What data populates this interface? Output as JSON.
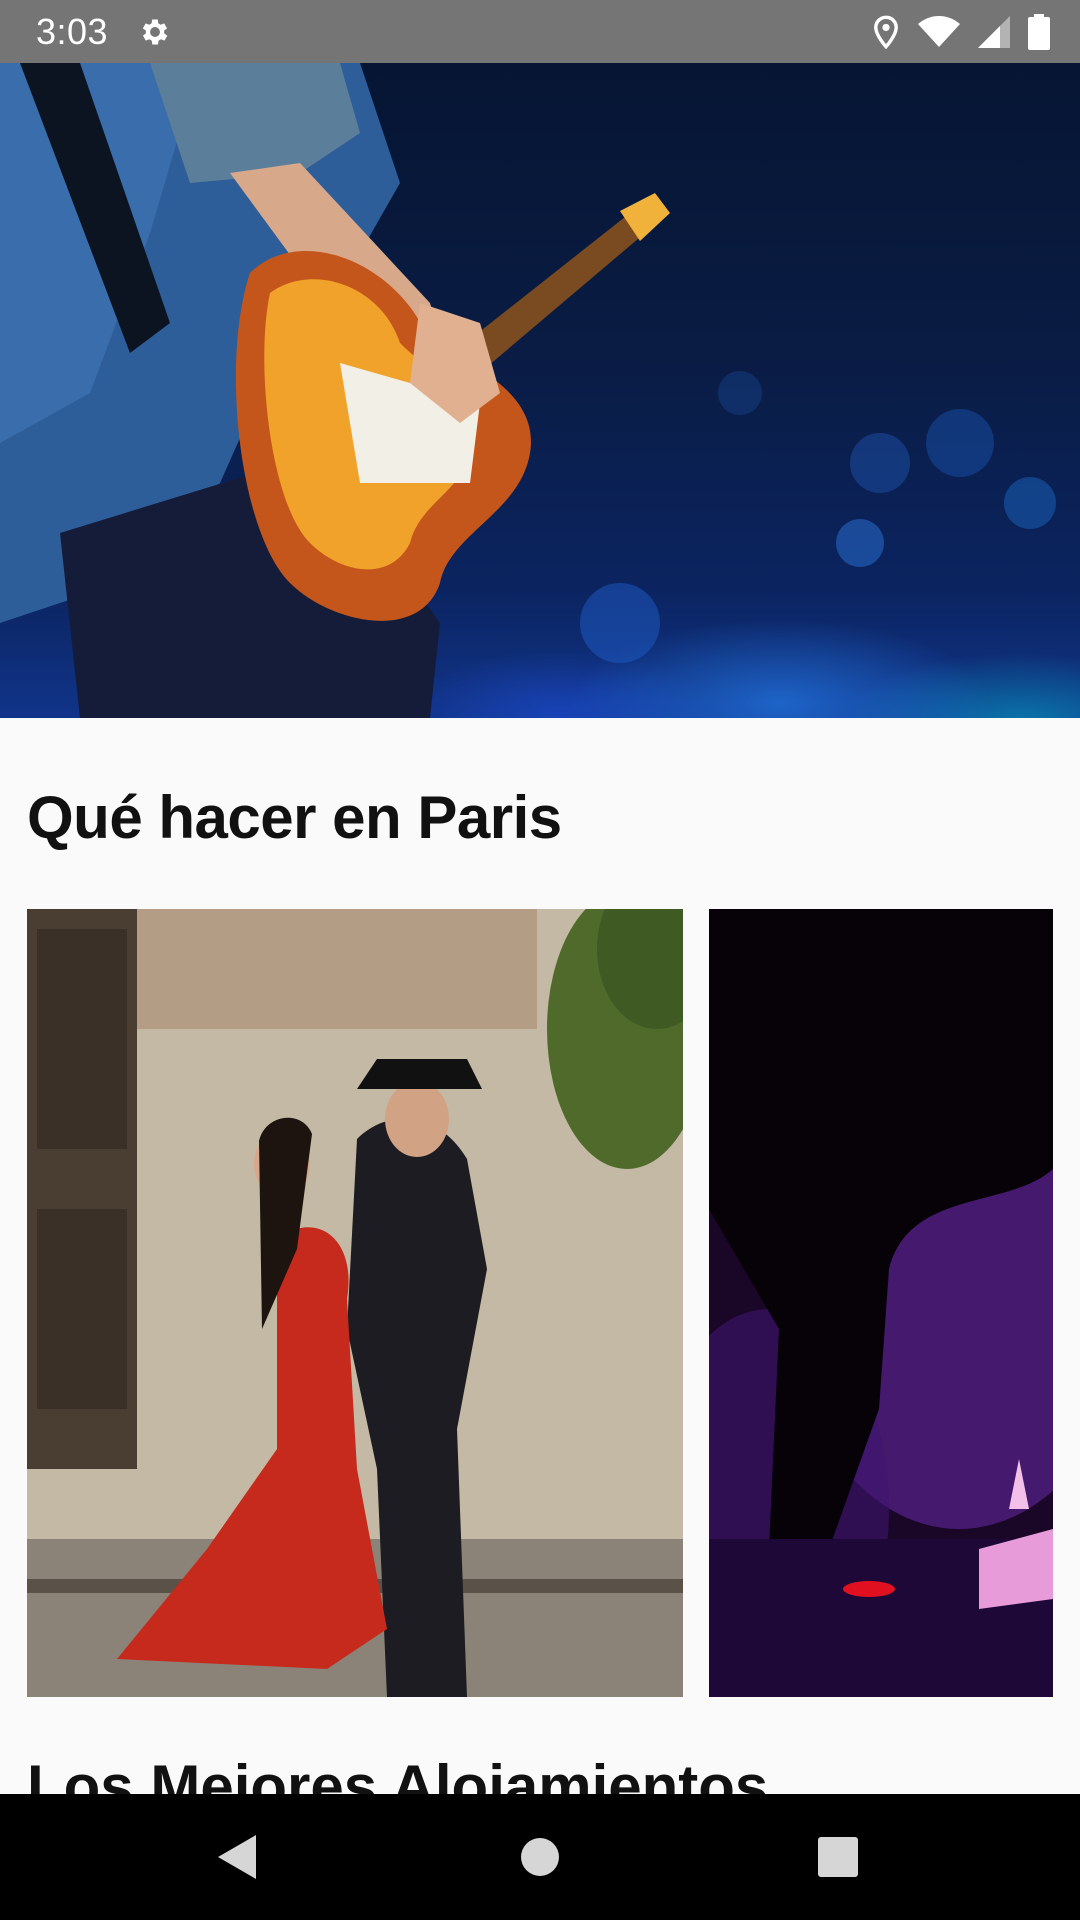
{
  "status_bar": {
    "time": "3:03",
    "icons": [
      "gear-icon",
      "location-icon",
      "wifi-icon",
      "signal-icon",
      "battery-icon"
    ],
    "background": "#757575"
  },
  "hero": {
    "image": "concert-guitarist-image"
  },
  "section": {
    "title": "Qué hacer en Paris",
    "cards": [
      {
        "image": "tango-dancers-image"
      },
      {
        "image": "dj-turntable-image"
      }
    ]
  },
  "next_section": {
    "title": "Los Mejores Alojamientos"
  },
  "nav_bar": {
    "icons": [
      "back-icon",
      "home-icon",
      "recents-icon"
    ]
  }
}
